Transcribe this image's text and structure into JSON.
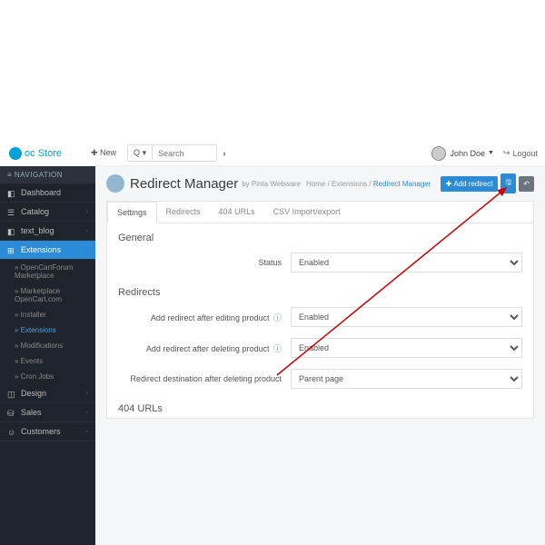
{
  "header": {
    "brand_prefix": "oc",
    "brand_name": "Store",
    "new_btn": "New",
    "search_placeholder": "Search",
    "search_btn": "Q",
    "user_name": "John Doe",
    "logout": "Logout"
  },
  "nav": {
    "heading": "NAVIGATION",
    "items": [
      {
        "label": "Dashboard"
      },
      {
        "label": "Catalog"
      },
      {
        "label": "text_blog"
      },
      {
        "label": "Extensions",
        "active": true
      },
      {
        "label": "Design"
      },
      {
        "label": "Sales"
      },
      {
        "label": "Customers"
      }
    ],
    "sub": [
      {
        "label": "OpenCartForum Marketplace"
      },
      {
        "label": "Marketplace OpenCart.com"
      },
      {
        "label": "Installer"
      },
      {
        "label": "Extensions",
        "active": true
      },
      {
        "label": "Modifications"
      },
      {
        "label": "Events"
      },
      {
        "label": "Cron Jobs"
      }
    ]
  },
  "page": {
    "title": "Redirect Manager",
    "subtitle": "by Pinta Webware",
    "breadcrumb_home": "Home",
    "breadcrumb_ext": "Extensions",
    "breadcrumb_current": "Redirect Manager",
    "add_btn": "Add redirect"
  },
  "tabs": [
    {
      "label": "Settings",
      "active": true
    },
    {
      "label": "Redirects"
    },
    {
      "label": "404 URLs"
    },
    {
      "label": "CSV Import/export"
    }
  ],
  "form": {
    "section_general": "General",
    "status_label": "Status",
    "status_value": "Enabled",
    "section_redirects": "Redirects",
    "add_edit_label": "Add redirect after editing product",
    "add_edit_value": "Enabled",
    "add_delete_label": "Add redirect after deleting product",
    "add_delete_value": "Enabled",
    "dest_label": "Redirect destination after deleting product",
    "dest_value": "Parent page",
    "section_404": "404 URLs"
  }
}
